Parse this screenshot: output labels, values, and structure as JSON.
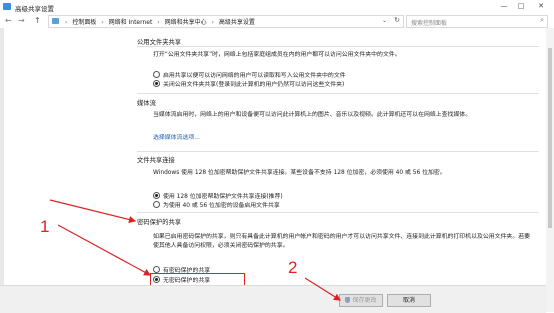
{
  "window": {
    "title": "高级共享设置",
    "controls": {
      "minimize": "—",
      "maximize": "□",
      "close": "✕"
    }
  },
  "nav": {
    "back": "←",
    "forward": "→",
    "up": "↑",
    "breadcrumbs": [
      "控制面板",
      "网络和 Internet",
      "网络和共享中心",
      "高级共享设置"
    ],
    "separator": "›",
    "search_placeholder": "搜索控制面板"
  },
  "sections": {
    "public_folder": {
      "title": "公用文件夹共享",
      "desc": "打开“公用文件夹共享”时，网络上包括家庭组成员在内的用户都可以访问公用文件夹中的文件。",
      "options": [
        {
          "label": "启用共享以便可以访问网络的用户可以读取和写入公用文件夹中的文件",
          "selected": false
        },
        {
          "label": "关闭公用文件夹共享(登录到此计算机的用户仍然可以访问这些文件夹)",
          "selected": true
        }
      ]
    },
    "media": {
      "title": "媒体流",
      "desc": "当媒体流启用时，网络上的用户和设备便可以访问此计算机上的图片、音乐以及视频。此计算机还可以在网络上查找媒体。",
      "link": "选择媒体流选项..."
    },
    "file_sharing": {
      "title": "文件共享连接",
      "desc": "Windows 使用 128 位加密帮助保护文件共享连接。某些设备不支持 128 位加密，必须使用 40 或 56 位加密。",
      "options": [
        {
          "label": "使用 128 位加密帮助保护文件共享连接(推荐)",
          "selected": true
        },
        {
          "label": "为使用 40 或 56 位加密的设备启用文件共享",
          "selected": false
        }
      ]
    },
    "password": {
      "title": "密码保护的共享",
      "desc": "如果已启用密码保护的共享，则只有具备此计算机的用户帐户和密码的用户才可以访问共享文件、连接到此计算机的打印机以及公用文件夹。若要使其他人具备访问权限，必须关闭密码保护的共享。",
      "options": [
        {
          "label": "有密码保护的共享",
          "selected": false
        },
        {
          "label": "无密码保护的共享",
          "selected": true
        }
      ]
    }
  },
  "footer": {
    "save_label": "保存更改",
    "cancel_label": "取消"
  },
  "annotations": {
    "marker1": "1",
    "marker2": "2",
    "color": "#dd2222"
  }
}
